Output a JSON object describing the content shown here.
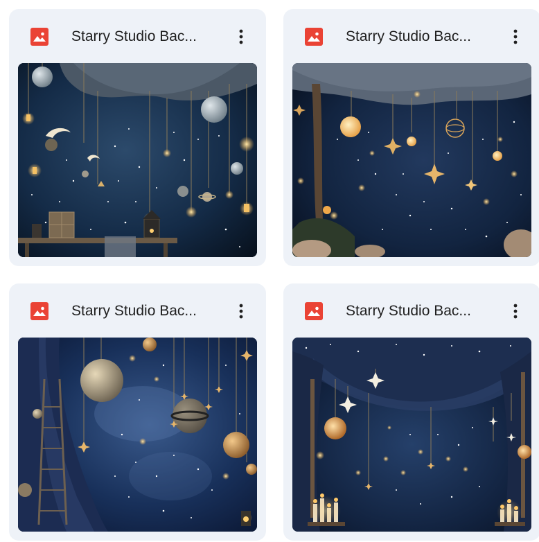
{
  "files": [
    {
      "title": "Starry Studio Bac...",
      "icon": "image-file-icon",
      "menu_icon": "more-vert-icon"
    },
    {
      "title": "Starry Studio Bac...",
      "icon": "image-file-icon",
      "menu_icon": "more-vert-icon"
    },
    {
      "title": "Starry Studio Bac...",
      "icon": "image-file-icon",
      "menu_icon": "more-vert-icon"
    },
    {
      "title": "Starry Studio Bac...",
      "icon": "image-file-icon",
      "menu_icon": "more-vert-icon"
    }
  ],
  "colors": {
    "card_background": "#eef2f8",
    "icon_red": "#ea4335",
    "title_text": "#1f1f1f"
  }
}
